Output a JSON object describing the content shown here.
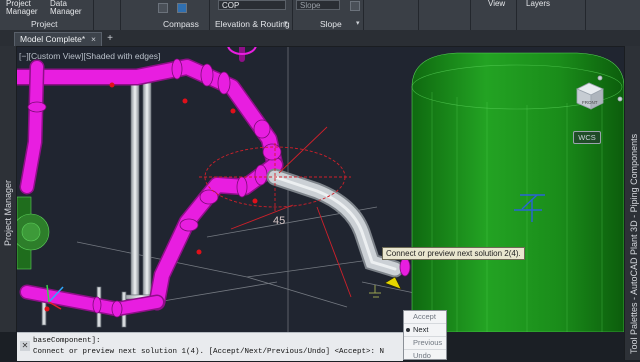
{
  "ribbon": {
    "buttons": {
      "project_manager": [
        "Project",
        "Manager"
      ],
      "data_manager": [
        "Data",
        "Manager"
      ]
    },
    "groups": {
      "project": "Project",
      "compass": "Compass",
      "elevation_routing": "Elevation & Routing",
      "slope": "Slope"
    },
    "elevation_combo_value": "COP",
    "slope_combo_value": "Slope",
    "top_right_labels": [
      "View",
      "Layers"
    ]
  },
  "document_tab": {
    "label": "Model Complete*",
    "close": "×",
    "new_tab": "+"
  },
  "viewport": {
    "label": "[−][Custom View][Shaded with edges]",
    "annotation": "45",
    "wcs_label": "WCS",
    "viewcube_face": "FRONT"
  },
  "left_palette_label": "Project Manager",
  "right_palette_label": "Tool Palettes - AutoCAD Plant 3D - Piping Components",
  "tooltip": "Connect or preview next solution 2(4).",
  "dynamic_menu": {
    "items": [
      "Accept",
      "Next",
      "Previous",
      "Undo"
    ],
    "selected": "Next"
  },
  "command_line": {
    "lines": [
      "baseComponent]:",
      "Connect or preview next solution 1(4). [Accept/Next/Previous/Undo] <Accept>: N"
    ]
  },
  "colors": {
    "pipe": "#e81ee0",
    "tank": "#1fa01f",
    "pump": "#2d7e2a",
    "steel": "#d8dde2",
    "selected_pipe": "#c9cdd2"
  }
}
